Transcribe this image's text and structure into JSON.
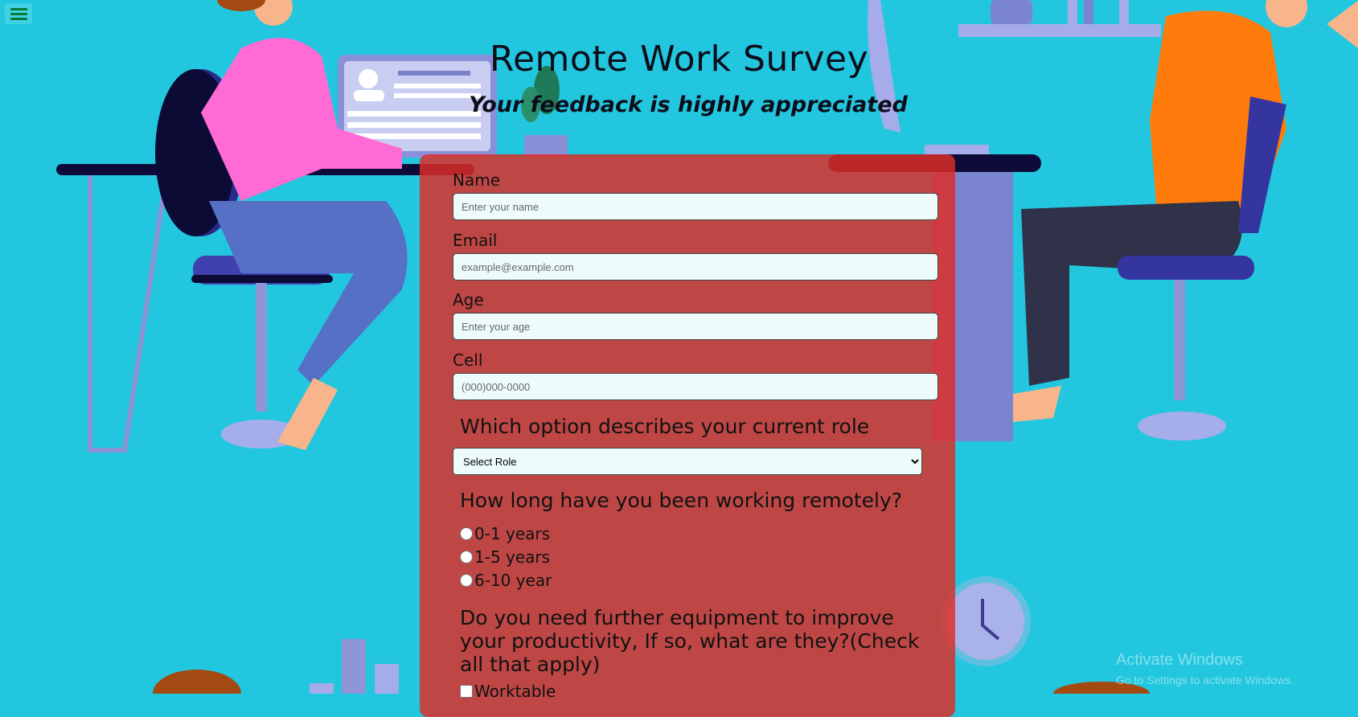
{
  "header": {
    "title": "Remote Work Survey",
    "subtitle": "Your feedback is highly appreciated"
  },
  "form": {
    "name_label": "Name",
    "name_placeholder": "Enter your name",
    "email_label": "Email",
    "email_placeholder": "example@example.com",
    "age_label": "Age",
    "age_placeholder": "Enter your age",
    "cell_label": "Cell",
    "cell_placeholder": "(000)000-0000",
    "role_question": "Which option describes your current role",
    "role_selected": "Select Role",
    "remote_question": "How long have you been working remotely?",
    "remote_options": [
      "0-1 years",
      "1-5 years",
      "6-10 year"
    ],
    "equipment_question": "Do you need further equipment to improve your productivity, If so, what are they?(Check all that apply)",
    "equipment_options": [
      "Worktable"
    ]
  },
  "watermark": {
    "line1": "Activate Windows",
    "line2": "Go to Settings to activate Windows."
  },
  "colors": {
    "background": "#22c7df",
    "panel": "#de2d26",
    "menu_icon": "#0a7a34"
  },
  "icons": {
    "menu": "hamburger-menu-icon"
  }
}
